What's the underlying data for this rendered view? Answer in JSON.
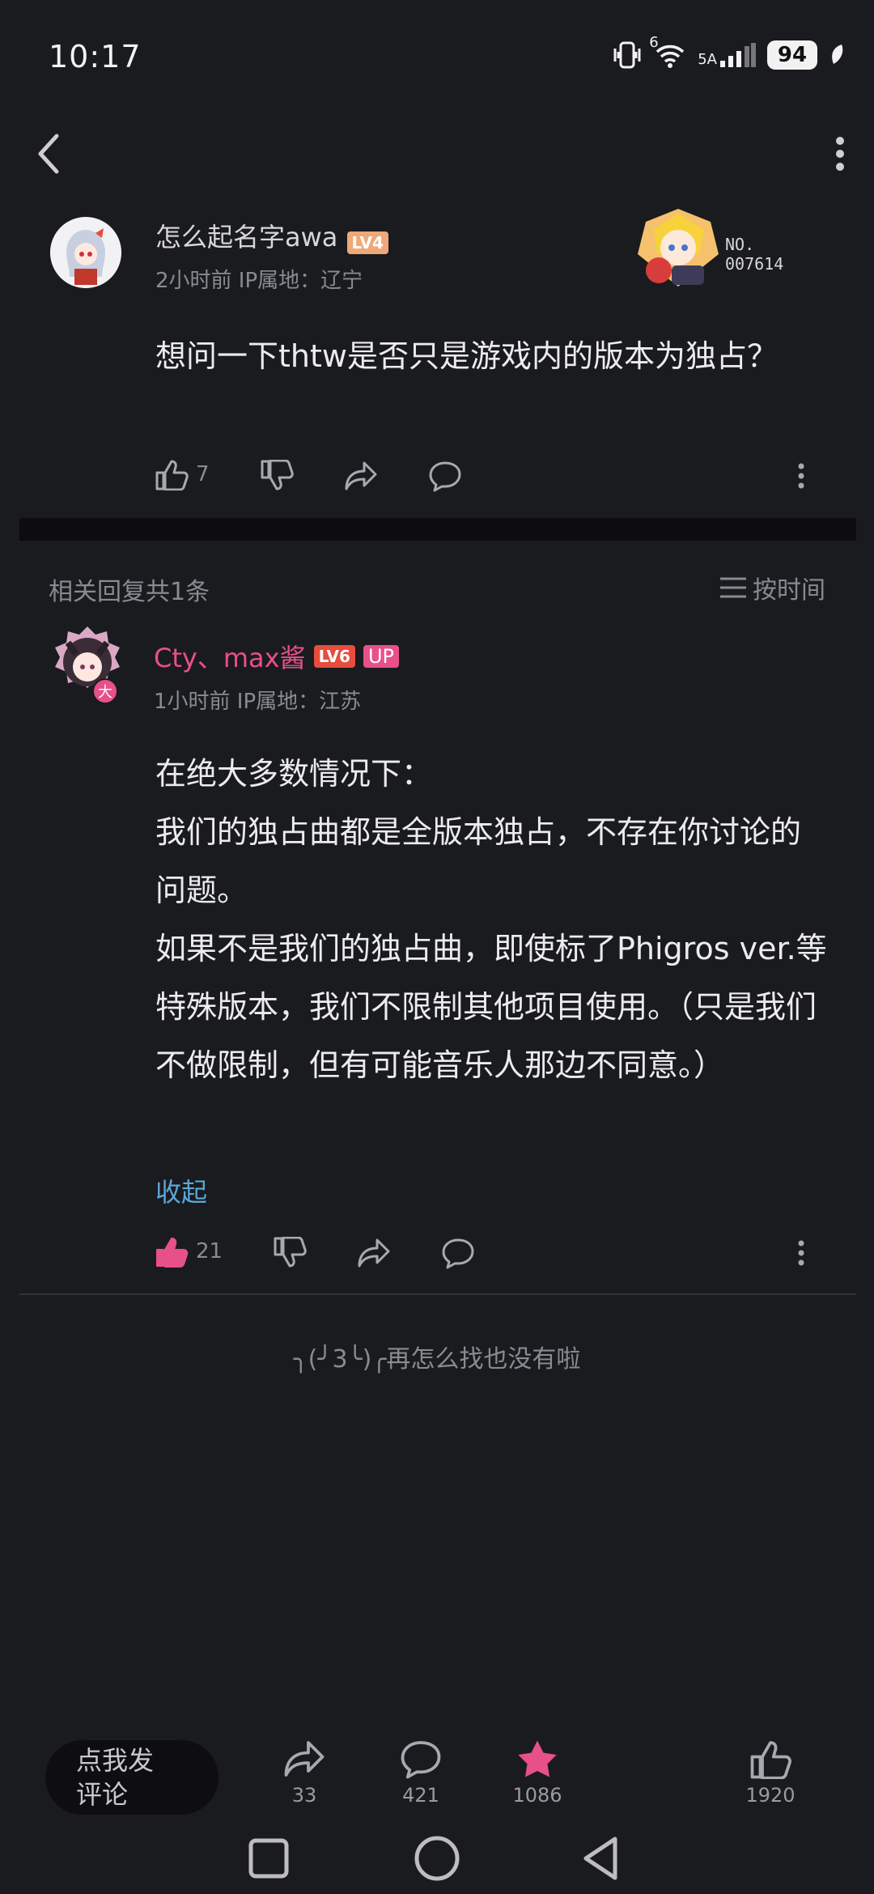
{
  "status_bar": {
    "time": "10:17",
    "battery": "94",
    "network_label": "6",
    "signal_label": "5A"
  },
  "post": {
    "username": "怎么起名字awa",
    "level": "LV4",
    "meta": "2小时前 IP属地：辽宁",
    "card_id": "NO.\n007614",
    "text": "想问一下thtw是否只是游戏内的版本为独占？",
    "likes": "7"
  },
  "replies_header": {
    "title": "相关回复共1条",
    "sort_label": "按时间"
  },
  "reply": {
    "username": "Cty、max酱",
    "level": "LV6",
    "up_badge": "UP",
    "avatar_badge": "大",
    "meta": "1小时前 IP属地：江苏",
    "text": "在绝大多数情况下：\n我们的独占曲都是全版本独占，不存在你讨论的问题。\n如果不是我们的独占曲，即使标了Phigros ver.等特殊版本，我们不限制其他项目使用。（只是我们不做限制，但有可能音乐人那边不同意。）",
    "collapse_label": "收起",
    "likes": "21"
  },
  "end_text": "╮(╯3╰)╭再怎么找也没有啦",
  "bottom_bar": {
    "comment_placeholder": "点我发评论",
    "share_count": "33",
    "comment_count": "421",
    "favorite_count": "1086",
    "like_count": "1920"
  },
  "colors": {
    "accent_pink": "#e8508a",
    "link_blue": "#5aa8d8",
    "bg": "#1a1b1f"
  }
}
